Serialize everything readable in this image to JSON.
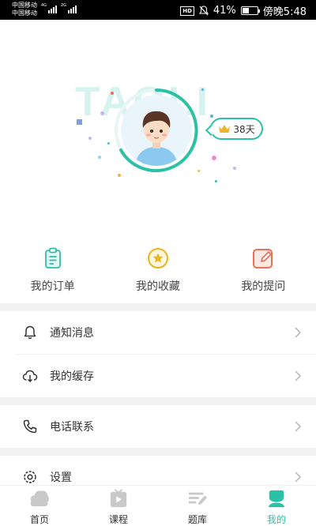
{
  "status_bar": {
    "carrier_1": "中国移动",
    "carrier_2": "中国移动",
    "net_1": "4G",
    "net_2": "2G",
    "hd": "HD",
    "battery": "41%",
    "time": "傍晚5:48"
  },
  "profile": {
    "watermark": "TAOLI",
    "days": "38天"
  },
  "quick_actions": [
    {
      "label": "我的订单",
      "icon": "order-icon"
    },
    {
      "label": "我的收藏",
      "icon": "star-icon"
    },
    {
      "label": "我的提问",
      "icon": "edit-icon"
    }
  ],
  "menu": {
    "notifications": "通知消息",
    "cache": "我的缓存",
    "phone": "电话联系",
    "settings": "设置"
  },
  "tabs": [
    {
      "label": "首页",
      "icon": "home-icon"
    },
    {
      "label": "课程",
      "icon": "play-icon"
    },
    {
      "label": "题库",
      "icon": "question-bank-icon"
    },
    {
      "label": "我的",
      "icon": "profile-icon"
    }
  ],
  "colors": {
    "accent": "#2cc1a7",
    "star": "#e8b61e",
    "edit": "#e8735a"
  }
}
